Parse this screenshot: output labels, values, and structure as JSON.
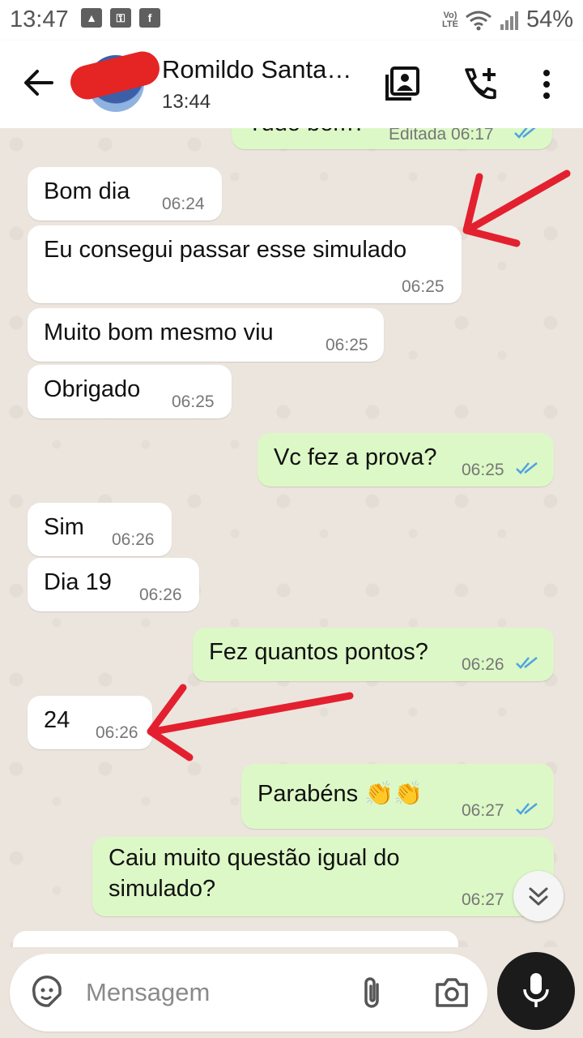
{
  "status_bar": {
    "time": "13:47",
    "network": "LTE",
    "battery": "54%"
  },
  "header": {
    "contact_name": "Romildo Santa…",
    "subtitle": "13:44"
  },
  "messages": [
    {
      "text": "Tudo bem?",
      "time": "Editada 06:17",
      "dir": "out"
    },
    {
      "text": "Bom dia",
      "time": "06:24",
      "dir": "in"
    },
    {
      "text": "Eu consegui passar esse simulado",
      "time": "06:25",
      "dir": "in"
    },
    {
      "text": "Muito bom mesmo viu",
      "time": "06:25",
      "dir": "in"
    },
    {
      "text": "Obrigado",
      "time": "06:25",
      "dir": "in"
    },
    {
      "text": "Vc fez a prova?",
      "time": "06:25",
      "dir": "out"
    },
    {
      "text": "Sim",
      "time": "06:26",
      "dir": "in"
    },
    {
      "text": "Dia 19",
      "time": "06:26",
      "dir": "in"
    },
    {
      "text": "Fez quantos pontos?",
      "time": "06:26",
      "dir": "out"
    },
    {
      "text": "24",
      "time": "06:26",
      "dir": "in"
    },
    {
      "text": "Parabéns 👏👏",
      "time": "06:27",
      "dir": "out"
    },
    {
      "text_line1": "Caiu muito questão igual do",
      "text_line2": "simulado?",
      "time": "06:27",
      "dir": "out"
    }
  ],
  "input": {
    "placeholder": "Mensagem"
  },
  "colors": {
    "outgoing_bubble": "#dcf8c6",
    "incoming_bubble": "#ffffff",
    "read_ticks": "#4fa3e0",
    "annotation_arrow": "#e3202f"
  },
  "icons": [
    "back-arrow-icon",
    "contact-card-icon",
    "add-call-icon",
    "more-vert-icon",
    "sticker-icon",
    "attach-icon",
    "camera-icon",
    "mic-icon",
    "double-chevron-down-icon"
  ]
}
